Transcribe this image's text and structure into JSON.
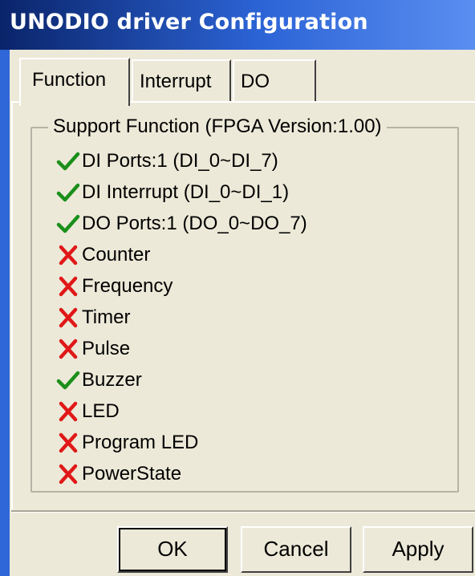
{
  "window": {
    "title": "UNODIO driver Configuration"
  },
  "tabs": [
    {
      "label": "Function",
      "selected": true
    },
    {
      "label": "Interrupt",
      "selected": false
    },
    {
      "label": "DO",
      "selected": false
    }
  ],
  "group": {
    "title": "Support Function (FPGA Version:1.00)"
  },
  "functions": [
    {
      "label": "DI Ports:1 (DI_0~DI_7)",
      "supported": true,
      "icon": "check-icon"
    },
    {
      "label": "DI Interrupt (DI_0~DI_1)",
      "supported": true,
      "icon": "check-icon"
    },
    {
      "label": "DO Ports:1 (DO_0~DO_7)",
      "supported": true,
      "icon": "check-icon"
    },
    {
      "label": "Counter",
      "supported": false,
      "icon": "cross-icon"
    },
    {
      "label": "Frequency",
      "supported": false,
      "icon": "cross-icon"
    },
    {
      "label": "Timer",
      "supported": false,
      "icon": "cross-icon"
    },
    {
      "label": "Pulse",
      "supported": false,
      "icon": "cross-icon"
    },
    {
      "label": "Buzzer",
      "supported": true,
      "icon": "check-icon"
    },
    {
      "label": "LED",
      "supported": false,
      "icon": "cross-icon"
    },
    {
      "label": "Program LED",
      "supported": false,
      "icon": "cross-icon"
    },
    {
      "label": "PowerState",
      "supported": false,
      "icon": "cross-icon"
    }
  ],
  "buttons": {
    "ok": "OK",
    "cancel": "Cancel",
    "apply": "Apply"
  },
  "colors": {
    "titlebar": "#0a246a",
    "check": "#1a8f1a",
    "cross": "#e01818",
    "face": "#ece9d8"
  }
}
